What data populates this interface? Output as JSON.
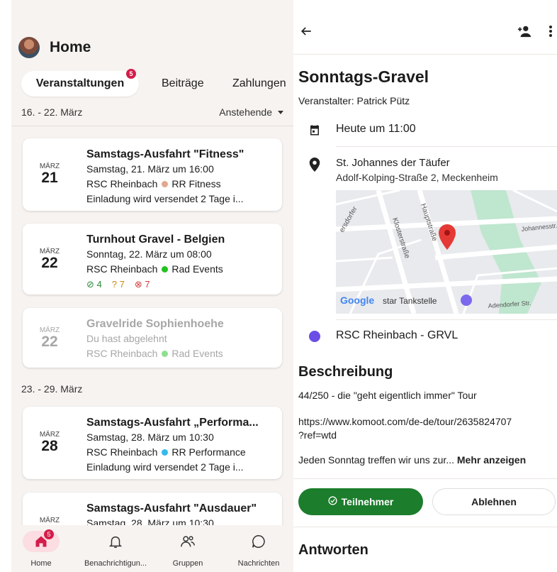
{
  "left": {
    "header": {
      "title": "Home"
    },
    "tabs": [
      {
        "label": "Veranstaltungen",
        "badge": "5"
      },
      {
        "label": "Beiträge"
      },
      {
        "label": "Zahlungen"
      }
    ],
    "week1": {
      "range": "16. - 22. März",
      "filter": "Anstehende"
    },
    "week2": {
      "range": "23. - 29. März"
    },
    "events": [
      {
        "month": "MÄRZ",
        "day": "21",
        "title": "Samstags-Ausfahrt \"Fitness\"",
        "when": "Samstag, 21. März um 16:00",
        "club": "RSC Rheinbach",
        "group": "RR Fitness",
        "groupColor": "#e2a88e",
        "extra": "Einladung wird versendet 2 Tage i..."
      },
      {
        "month": "MÄRZ",
        "day": "22",
        "title": "Turnhout Gravel - Belgien",
        "when": "Sonntag, 22. März um 08:00",
        "club": "RSC Rheinbach",
        "group": "Rad Events",
        "groupColor": "#22c21f",
        "yes": "4",
        "maybe": "7",
        "no": "7"
      },
      {
        "month": "MÄRZ",
        "day": "22",
        "title": "Gravelride Sophienhoehe",
        "when": "Du hast abgelehnt",
        "club": "RSC Rheinbach",
        "group": "Rad Events",
        "groupColor": "#8fe08d"
      },
      {
        "month": "MÄRZ",
        "day": "28",
        "title": "Samstags-Ausfahrt „Performa...",
        "when": "Samstag, 28. März um 10:30",
        "club": "RSC Rheinbach",
        "group": "RR Performance",
        "groupColor": "#35b9ee",
        "extra": "Einladung wird versendet 2 Tage i..."
      },
      {
        "month": "MÄRZ",
        "title": "Samstags-Ausfahrt \"Ausdauer\"",
        "when": "Samstag, 28. März um 10:30"
      }
    ],
    "nav": [
      {
        "label": "Home",
        "badge": "5"
      },
      {
        "label": "Benachrichtigun..."
      },
      {
        "label": "Gruppen"
      },
      {
        "label": "Nachrichten"
      }
    ]
  },
  "right": {
    "title": "Sonntags-Gravel",
    "organizer": "Veranstalter: Patrick Pütz",
    "time": "Heute um 11:00",
    "location": {
      "name": "St. Johannes der Täufer",
      "address": "Adolf-Kolping-Straße 2, Meckenheim"
    },
    "map": {
      "streets": [
        "Hauptstraße",
        "Klosterstraße",
        "Johannesstr.",
        "Adendorfer Str.",
        "ersdorfer"
      ],
      "poi": "star Tankstelle",
      "brand": "Google"
    },
    "group": "RSC Rheinbach  - GRVL",
    "description": {
      "heading": "Beschreibung",
      "line1": "44/250 - die \"geht eigentlich immer\" Tour",
      "url1": "https://www.komoot.com/de-de/tour/2635824707",
      "url2": "?ref=wtd",
      "teaser": "Jeden Sonntag treffen wir uns zur...",
      "more": "Mehr anzeigen"
    },
    "buttons": {
      "join": "Teilnehmer",
      "decline": "Ablehnen"
    },
    "answers": {
      "heading": "Antworten"
    }
  }
}
